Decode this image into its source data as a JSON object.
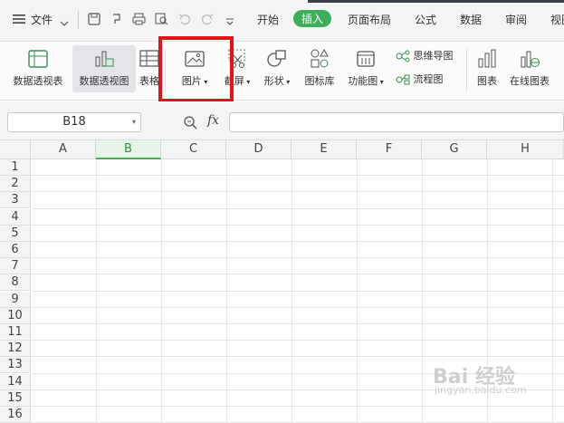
{
  "menu": {
    "label": "文件"
  },
  "tabs": [
    {
      "label": "开始",
      "active": false
    },
    {
      "label": "插入",
      "active": true
    },
    {
      "label": "页面布局",
      "active": false
    },
    {
      "label": "公式",
      "active": false
    },
    {
      "label": "数据",
      "active": false
    },
    {
      "label": "审阅",
      "active": false
    },
    {
      "label": "视图",
      "active": false
    }
  ],
  "ribbon": {
    "pivot_table": "数据透视表",
    "pivot_chart": "数据透视图",
    "table": "表格",
    "picture": "图片",
    "screenshot": "截屏",
    "shapes": "形状",
    "icon_library": "图标库",
    "function_chart": "功能图",
    "mind_map": "思维导图",
    "flowchart": "流程图",
    "chart": "图表",
    "online_chart": "在线图表"
  },
  "formula_bar": {
    "name_box": "B18",
    "fx": "fx"
  },
  "columns": [
    "A",
    "B",
    "C",
    "D",
    "E",
    "F",
    "G",
    "H"
  ],
  "rows": [
    "1",
    "2",
    "3",
    "4",
    "5",
    "6",
    "7",
    "8",
    "9",
    "10",
    "11",
    "12",
    "13",
    "14",
    "15",
    "16"
  ],
  "watermark": {
    "text": "Bai 经验",
    "sub": "jingyan.baidu.com"
  },
  "colors": {
    "accent": "#3fae5a",
    "highlight": "#e8101a"
  }
}
